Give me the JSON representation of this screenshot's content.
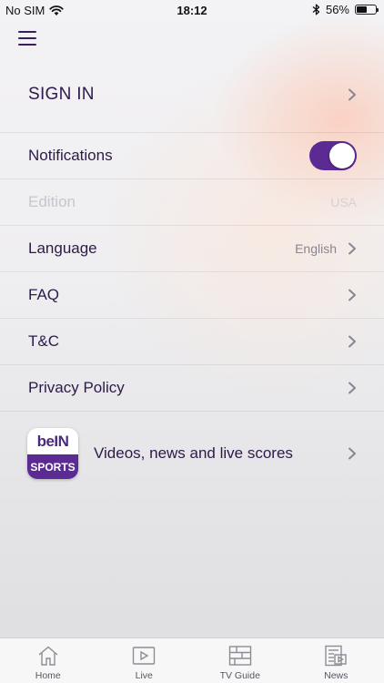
{
  "status_bar": {
    "carrier": "No SIM",
    "time": "18:12",
    "battery": "56%",
    "battery_level": 0.56
  },
  "settings": {
    "sign_in": "SIGN IN",
    "notifications": {
      "label": "Notifications",
      "enabled": true
    },
    "edition": {
      "label": "Edition",
      "value": "USA"
    },
    "language": {
      "label": "Language",
      "value": "English"
    },
    "faq": "FAQ",
    "tc": "T&C",
    "privacy": "Privacy Policy"
  },
  "promo": {
    "logo_top": "beIN",
    "logo_bottom": "SPORTS",
    "text": "Videos, news and live scores"
  },
  "tabbar": {
    "home": "Home",
    "live": "Live",
    "tv_guide": "TV Guide",
    "news": "News"
  },
  "colors": {
    "accent": "#5b2b93",
    "text": "#2d1a4b",
    "secondary": "#8a8593"
  }
}
